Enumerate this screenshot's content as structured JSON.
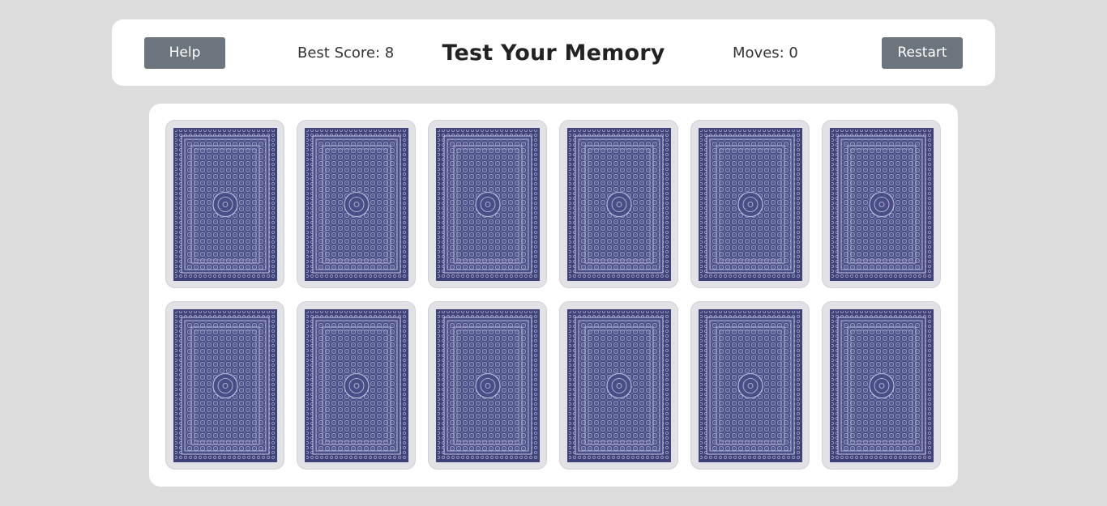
{
  "header": {
    "help_label": "Help",
    "best_score_text": "Best Score: 8",
    "title": "Test Your Memory",
    "moves_text": "Moves: 0",
    "restart_label": "Restart"
  },
  "board": {
    "rows": 2,
    "columns": 6,
    "cards": [
      {
        "state": "face-down"
      },
      {
        "state": "face-down"
      },
      {
        "state": "face-down"
      },
      {
        "state": "face-down"
      },
      {
        "state": "face-down"
      },
      {
        "state": "face-down"
      },
      {
        "state": "face-down"
      },
      {
        "state": "face-down"
      },
      {
        "state": "face-down"
      },
      {
        "state": "face-down"
      },
      {
        "state": "face-down"
      },
      {
        "state": "face-down"
      }
    ]
  },
  "colors": {
    "page_background": "#dcdcdc",
    "panel_background": "#ffffff",
    "button_background": "#6c757d",
    "card_back": "#4a4e86",
    "card_frame": "#e2e2e6"
  }
}
